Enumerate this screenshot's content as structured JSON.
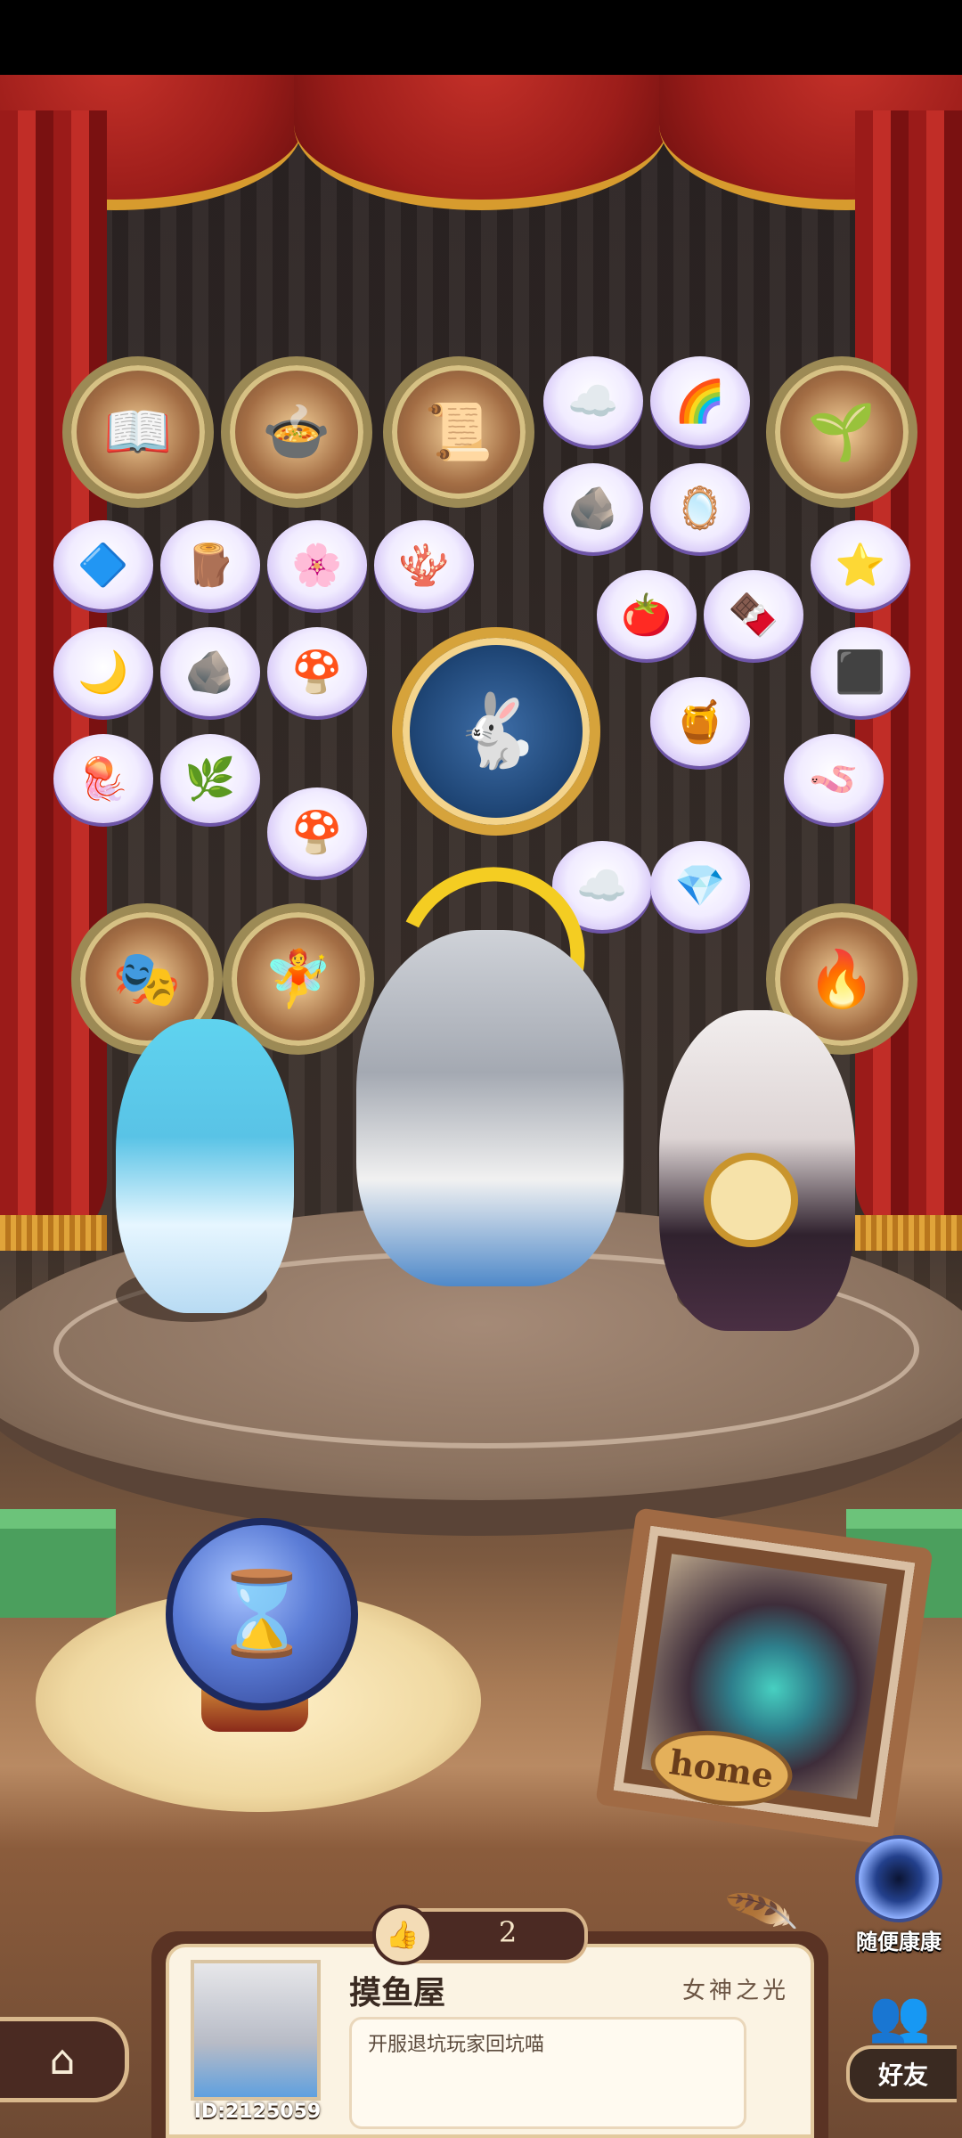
{
  "stage": {
    "home_plate_label": "home",
    "random_visit_label": "随便康康"
  },
  "profile": {
    "like_count": "2",
    "house_name": "摸鱼屋",
    "title": "女神之光",
    "motto": "开服退坑玩家回坑喵",
    "user_id": "ID:2125059"
  },
  "nav": {
    "friends_label": "好友"
  },
  "icons": {
    "home": "home-icon",
    "like": "thumbs-up-icon",
    "hourglass": "hourglass-icon",
    "random_visit": "portal-icon",
    "friends": "friends-icon",
    "quill": "quill-icon"
  },
  "colors": {
    "curtain": "#b0231f",
    "panel_dark": "#4b2a23",
    "panel_light": "#fbf3e3",
    "accent_gold": "#d6a33b"
  }
}
